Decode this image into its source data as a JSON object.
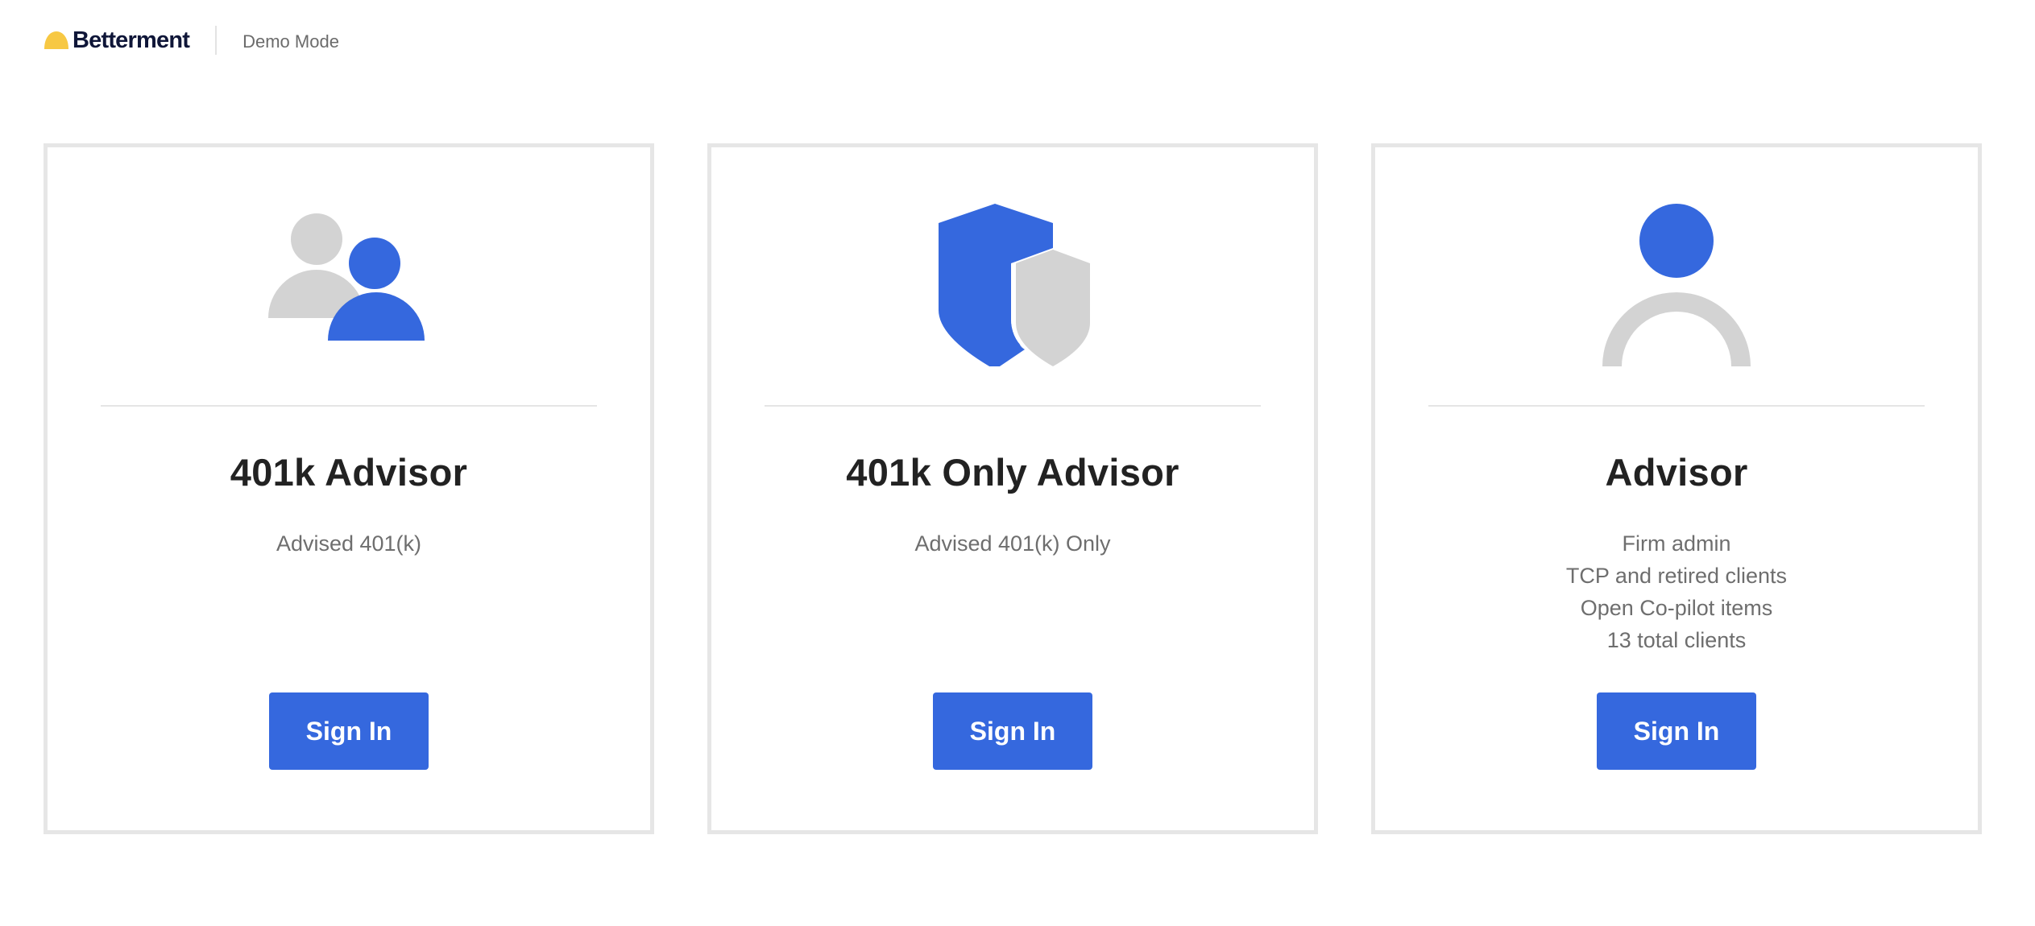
{
  "header": {
    "brand_name": "Betterment",
    "brand_icon": "betterment-sun-logo",
    "mode_label": "Demo Mode"
  },
  "colors": {
    "accent": "#3568de",
    "icon_gray": "#d3d3d3",
    "brand_yellow": "#f7c843",
    "brand_navy": "#0f1638"
  },
  "cards": [
    {
      "icon": "two-users-icon",
      "title": "401k Advisor",
      "description": [
        "Advised 401(k)"
      ],
      "button_label": "Sign In"
    },
    {
      "icon": "shield-icon",
      "title": "401k Only Advisor",
      "description": [
        "Advised 401(k) Only"
      ],
      "button_label": "Sign In"
    },
    {
      "icon": "user-icon",
      "title": "Advisor",
      "description": [
        "Firm admin",
        "TCP and retired clients",
        "Open Co-pilot items",
        "13 total clients"
      ],
      "button_label": "Sign In"
    }
  ]
}
